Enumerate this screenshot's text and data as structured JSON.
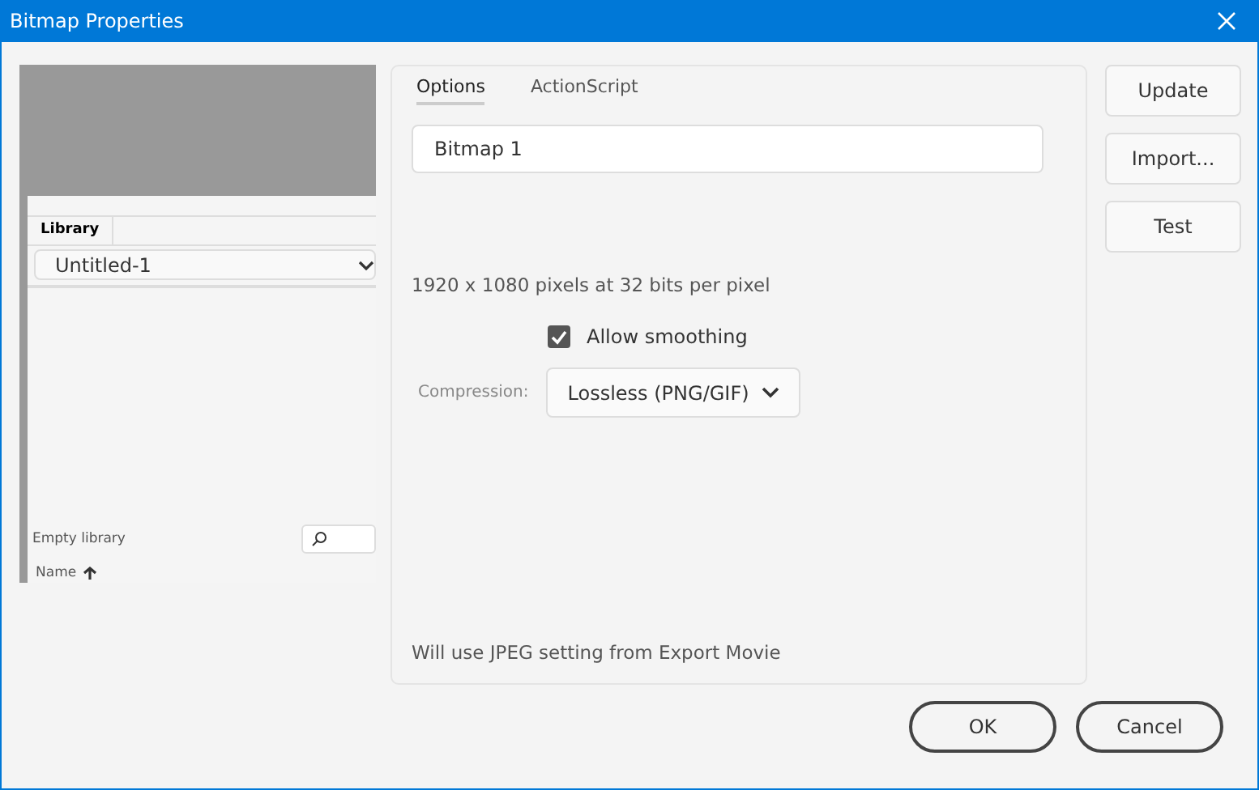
{
  "window": {
    "title": "Bitmap Properties"
  },
  "preview": {
    "panel_tab": "Library",
    "document": "Untitled-1",
    "status": "Empty library",
    "column": "Name"
  },
  "tabs": [
    {
      "label": "Options",
      "selected": true
    },
    {
      "label": "ActionScript",
      "selected": false
    }
  ],
  "name_field": {
    "value": "Bitmap 1"
  },
  "info": "1920 x 1080 pixels at 32 bits per pixel",
  "allow_smoothing": {
    "label": "Allow smoothing",
    "checked": true
  },
  "compression": {
    "label": "Compression:",
    "value": "Lossless (PNG/GIF)"
  },
  "note": "Will use JPEG setting from Export Movie",
  "side_buttons": [
    "Update",
    "Import...",
    "Test"
  ],
  "buttons": [
    "OK",
    "Cancel"
  ]
}
